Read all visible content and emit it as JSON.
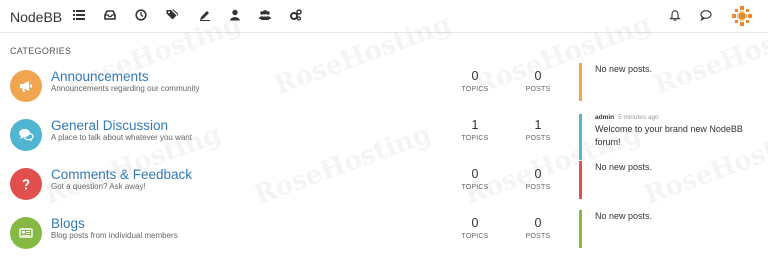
{
  "navbar": {
    "brand": "NodeBB",
    "icons": [
      "list-icon",
      "inbox-icon",
      "clock-icon",
      "tags-icon",
      "pencil-icon",
      "user-icon",
      "users-icon",
      "gears-icon"
    ],
    "right_icons": [
      "bell-icon",
      "chat-icon"
    ]
  },
  "section_heading": "CATEGORIES",
  "categories": [
    {
      "title": "Announcements",
      "description": "Announcements regarding our community",
      "color": "#f0a64e",
      "icon": "bullhorn-icon",
      "topics": "0",
      "posts": "0",
      "teaser": "No new posts."
    },
    {
      "title": "General Discussion",
      "description": "A place to talk about whatever you want",
      "color": "#50b5d0",
      "icon": "comments-icon",
      "topics": "1",
      "posts": "1",
      "teaser_user": "admin",
      "teaser_time": "5 minutes ago",
      "teaser": "Welcome to your brand new NodeBB forum!"
    },
    {
      "title": "Comments & Feedback",
      "description": "Got a question? Ask away!",
      "color": "#e24f4f",
      "icon": "question-icon",
      "topics": "0",
      "posts": "0",
      "teaser": "No new posts."
    },
    {
      "title": "Blogs",
      "description": "Blog posts from individual members",
      "color": "#86b944",
      "icon": "newspaper-icon",
      "topics": "0",
      "posts": "0",
      "teaser": "No new posts."
    }
  ],
  "labels": {
    "topics": "TOPICS",
    "posts": "POSTS"
  },
  "watermark": "RoseHosting"
}
